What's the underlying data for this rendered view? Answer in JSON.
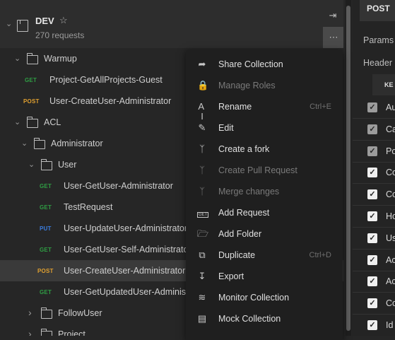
{
  "collection": {
    "name": "DEV",
    "subtitle": "270 requests"
  },
  "tree": [
    {
      "type": "folder",
      "name": "Warmup"
    },
    {
      "type": "request",
      "method": "GET",
      "name": "Project-GetAllProjects-Guest"
    },
    {
      "type": "request",
      "method": "POST",
      "name": "User-CreateUser-Administrator"
    },
    {
      "type": "folder",
      "name": "ACL"
    },
    {
      "type": "folder",
      "name": "Administrator"
    },
    {
      "type": "folder",
      "name": "User"
    },
    {
      "type": "request",
      "method": "GET",
      "name": "User-GetUser-Administrator"
    },
    {
      "type": "request",
      "method": "GET",
      "name": "TestRequest"
    },
    {
      "type": "request",
      "method": "PUT",
      "name": "User-UpdateUser-Administrator"
    },
    {
      "type": "request",
      "method": "GET",
      "name": "User-GetUser-Self-Administrator"
    },
    {
      "type": "request",
      "method": "POST",
      "name": "User-CreateUser-Administrator"
    },
    {
      "type": "request",
      "method": "GET",
      "name": "User-GetUpdatedUser-Administrator"
    },
    {
      "type": "folder",
      "name": "FollowUser"
    },
    {
      "type": "folder",
      "name": "Project"
    }
  ],
  "menu": [
    {
      "label": "Share Collection",
      "icon": "share-icon",
      "disabled": false,
      "shortcut": ""
    },
    {
      "label": "Manage Roles",
      "icon": "lock-icon",
      "disabled": true,
      "shortcut": ""
    },
    {
      "label": "Rename",
      "icon": "rename-icon",
      "disabled": false,
      "shortcut": "Ctrl+E"
    },
    {
      "label": "Edit",
      "icon": "pencil-icon",
      "disabled": false,
      "shortcut": ""
    },
    {
      "label": "Create a fork",
      "icon": "fork-icon",
      "disabled": false,
      "shortcut": ""
    },
    {
      "label": "Create Pull Request",
      "icon": "pull-request-icon",
      "disabled": true,
      "shortcut": ""
    },
    {
      "label": "Merge changes",
      "icon": "merge-icon",
      "disabled": true,
      "shortcut": ""
    },
    {
      "label": "Add Request",
      "icon": "get-request-icon",
      "disabled": false,
      "shortcut": ""
    },
    {
      "label": "Add Folder",
      "icon": "add-folder-icon",
      "disabled": false,
      "shortcut": ""
    },
    {
      "label": "Duplicate",
      "icon": "duplicate-icon",
      "disabled": false,
      "shortcut": "Ctrl+D"
    },
    {
      "label": "Export",
      "icon": "export-icon",
      "disabled": false,
      "shortcut": ""
    },
    {
      "label": "Monitor Collection",
      "icon": "monitor-icon",
      "disabled": false,
      "shortcut": ""
    },
    {
      "label": "Mock Collection",
      "icon": "mock-icon",
      "disabled": false,
      "shortcut": ""
    }
  ],
  "right_panel": {
    "method_tab": "POST",
    "tabs": [
      "Params",
      "Header"
    ],
    "key_header": "KE",
    "rows": [
      {
        "key": "Au",
        "checked": true,
        "dim": true
      },
      {
        "key": "Ca",
        "checked": true,
        "dim": true
      },
      {
        "key": "Po",
        "checked": true,
        "dim": true
      },
      {
        "key": "Co",
        "checked": true,
        "dim": false
      },
      {
        "key": "Co",
        "checked": true,
        "dim": false
      },
      {
        "key": "Ho",
        "checked": true,
        "dim": false
      },
      {
        "key": "Us",
        "checked": true,
        "dim": false
      },
      {
        "key": "Ac",
        "checked": true,
        "dim": false
      },
      {
        "key": "Ac",
        "checked": true,
        "dim": false
      },
      {
        "key": "Co",
        "checked": true,
        "dim": false
      },
      {
        "key": "Id",
        "checked": true,
        "dim": false
      }
    ]
  },
  "colors": {
    "GET": "#2f9e44",
    "POST": "#e0a030",
    "PUT": "#3b7de0"
  }
}
